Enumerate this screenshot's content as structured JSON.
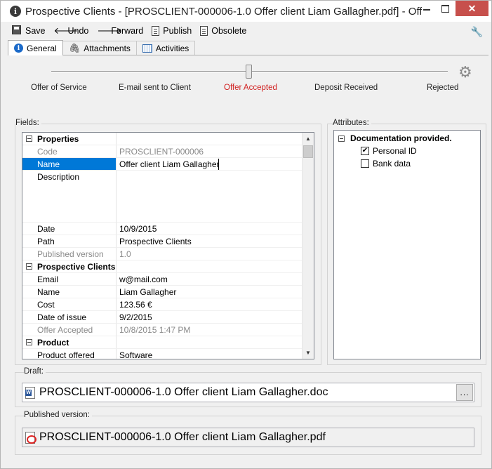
{
  "window": {
    "title": "Prospective Clients - [PROSCLIENT-000006-1.0 Offer client Liam Gallagher.pdf] - Offer",
    "close_label": "✕"
  },
  "toolbar": {
    "save_label": "Save",
    "undo_label": "Undo",
    "forward_label": "Forward",
    "publish_label": "Publish",
    "obsolete_label": "Obsolete"
  },
  "tabs": [
    {
      "label": "General",
      "icon": "info-icon",
      "active": true
    },
    {
      "label": "Attachments",
      "icon": "paperclip-icon",
      "active": false
    },
    {
      "label": "Activities",
      "icon": "calendar-icon",
      "active": false
    }
  ],
  "workflow": {
    "stages": [
      "Offer of Service",
      "E-mail sent to Client",
      "Offer Accepted",
      "Deposit Received",
      "Rejected"
    ],
    "current_stage": "Offer Accepted",
    "current_color": "#d12020"
  },
  "fields": {
    "label": "Fields:",
    "properties": {
      "category": "Properties",
      "code_name": "Code",
      "code_value": "PROSCLIENT-000006",
      "name_name": "Name",
      "name_value": "Offer client Liam Gallagher",
      "description_name": "Description",
      "description_value": "",
      "date_name": "Date",
      "date_value": "10/9/2015",
      "path_name": "Path",
      "path_value": "Prospective Clients",
      "published_name": "Published version",
      "published_value": "1.0"
    },
    "prospective": {
      "category": "Prospective Clients",
      "email_name": "Email",
      "email_value": "w@mail.com",
      "name_name": "Name",
      "name_value": "Liam Gallagher",
      "cost_name": "Cost",
      "cost_value": "123.56 €",
      "issue_name": "Date of issue",
      "issue_value": "9/2/2015",
      "accepted_name": "Offer Accepted",
      "accepted_value": "10/8/2015 1:47 PM"
    },
    "product": {
      "category": "Product",
      "offered_name": "Product offered",
      "offered_value": "Software"
    }
  },
  "attributes": {
    "label": "Attributes:",
    "category": "Documentation provided.",
    "items": [
      {
        "label": "Personal ID",
        "checked": true
      },
      {
        "label": "Bank data",
        "checked": false
      }
    ]
  },
  "draft": {
    "label": "Draft:",
    "file": "PROSCLIENT-000006-1.0 Offer client Liam Gallagher.doc",
    "browse_label": "..."
  },
  "published": {
    "label": "Published version:",
    "file": "PROSCLIENT-000006-1.0 Offer client Liam Gallagher.pdf"
  },
  "colors": {
    "selection": "#0078d7",
    "close_button": "#c7504c"
  }
}
